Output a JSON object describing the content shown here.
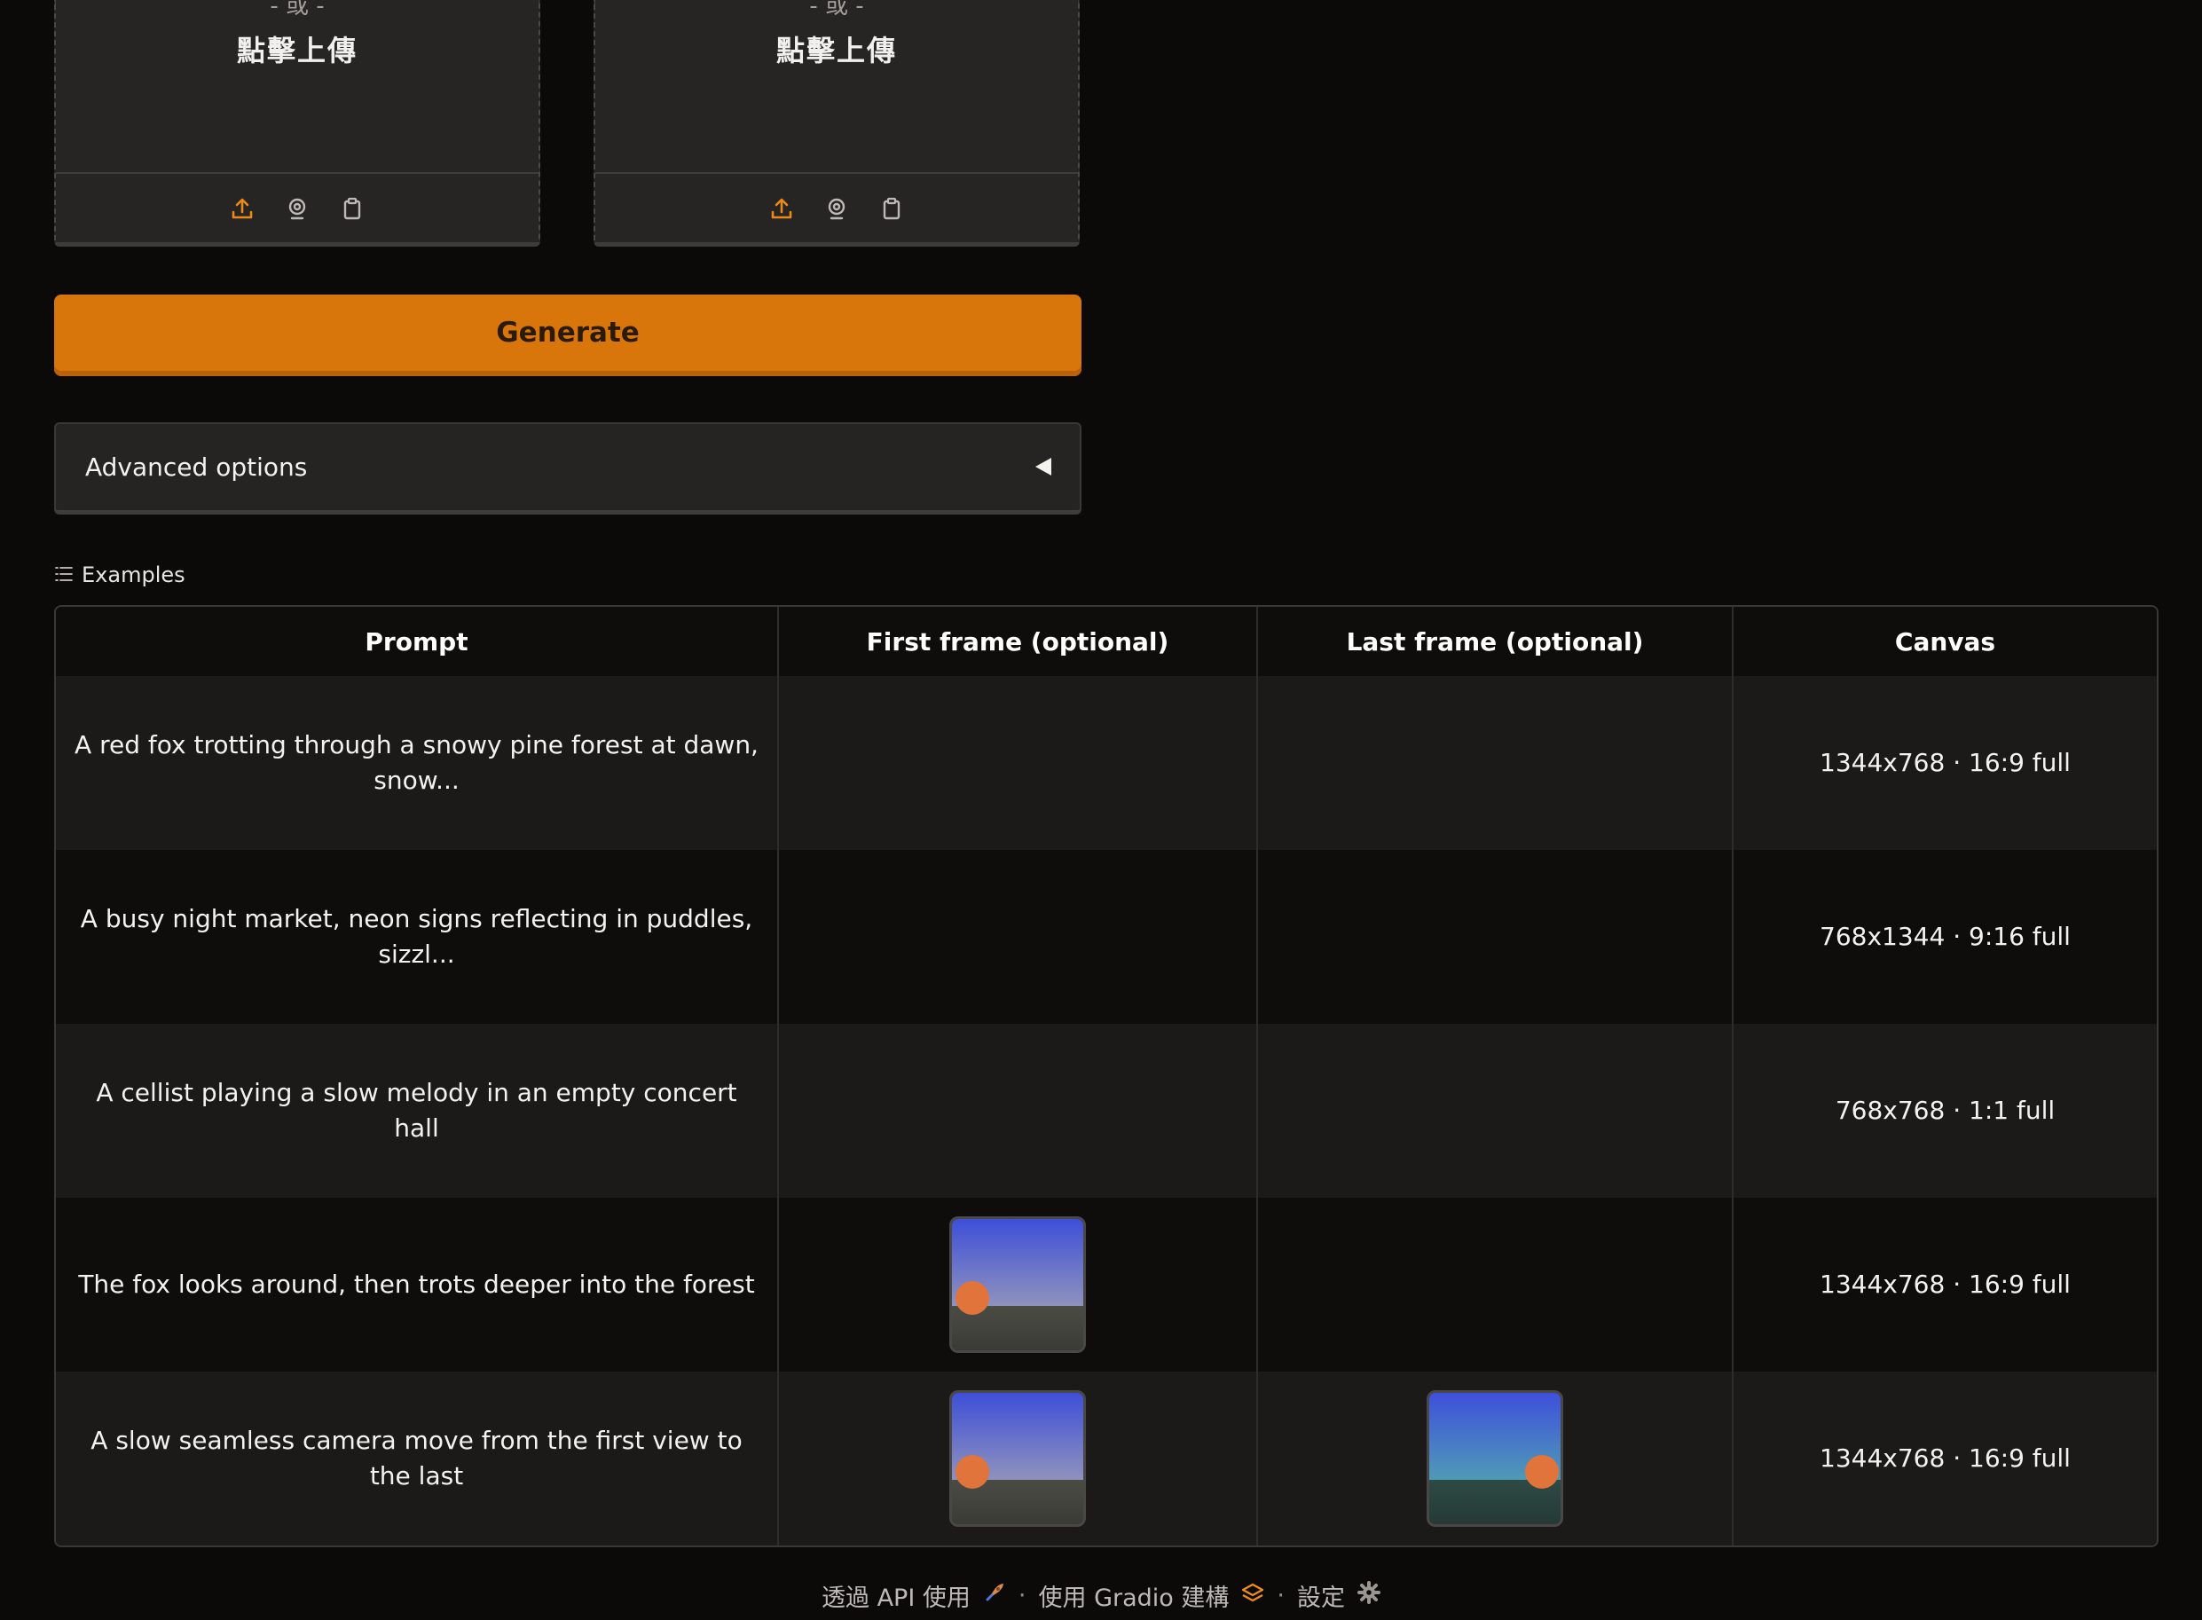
{
  "uploads": [
    {
      "or_text": "- 或 -",
      "click_text": "點擊上傳",
      "icons": [
        "upload-icon",
        "webcam-icon",
        "clipboard-icon"
      ]
    },
    {
      "or_text": "- 或 -",
      "click_text": "點擊上傳",
      "icons": [
        "upload-icon",
        "webcam-icon",
        "clipboard-icon"
      ]
    }
  ],
  "generate": {
    "label": "Generate"
  },
  "advanced": {
    "label": "Advanced options",
    "caret_icon": "caret-left-icon"
  },
  "examples": {
    "label": "Examples",
    "icon": "list-icon",
    "headers": [
      "Prompt",
      "First frame (optional)",
      "Last frame (optional)",
      "Canvas"
    ],
    "rows": [
      {
        "prompt": "A red fox trotting through a snowy pine forest at dawn, snow...",
        "first_frame": false,
        "last_frame": false,
        "canvas": "1344x768 · 16:9 full"
      },
      {
        "prompt": "A busy night market, neon signs reflecting in puddles, sizzl...",
        "first_frame": false,
        "last_frame": false,
        "canvas": "768x1344 · 9:16 full"
      },
      {
        "prompt": "A cellist playing a slow melody in an empty concert hall",
        "first_frame": false,
        "last_frame": false,
        "canvas": "768x768 · 1:1 full"
      },
      {
        "prompt": "The fox looks around, then trots deeper into the forest",
        "first_frame": true,
        "last_frame": false,
        "canvas": "1344x768 · 16:9 full"
      },
      {
        "prompt": "A slow seamless camera move from the first view to the last",
        "first_frame": true,
        "last_frame": true,
        "canvas": "1344x768 · 16:9 full"
      }
    ]
  },
  "footer": {
    "api_link": "透過 API 使用",
    "built_with": "使用 Gradio 建構",
    "settings": "設定",
    "separator": "·"
  },
  "colors": {
    "accent": "#d9760b",
    "background": "#0b0a09",
    "panel": "#272524"
  }
}
